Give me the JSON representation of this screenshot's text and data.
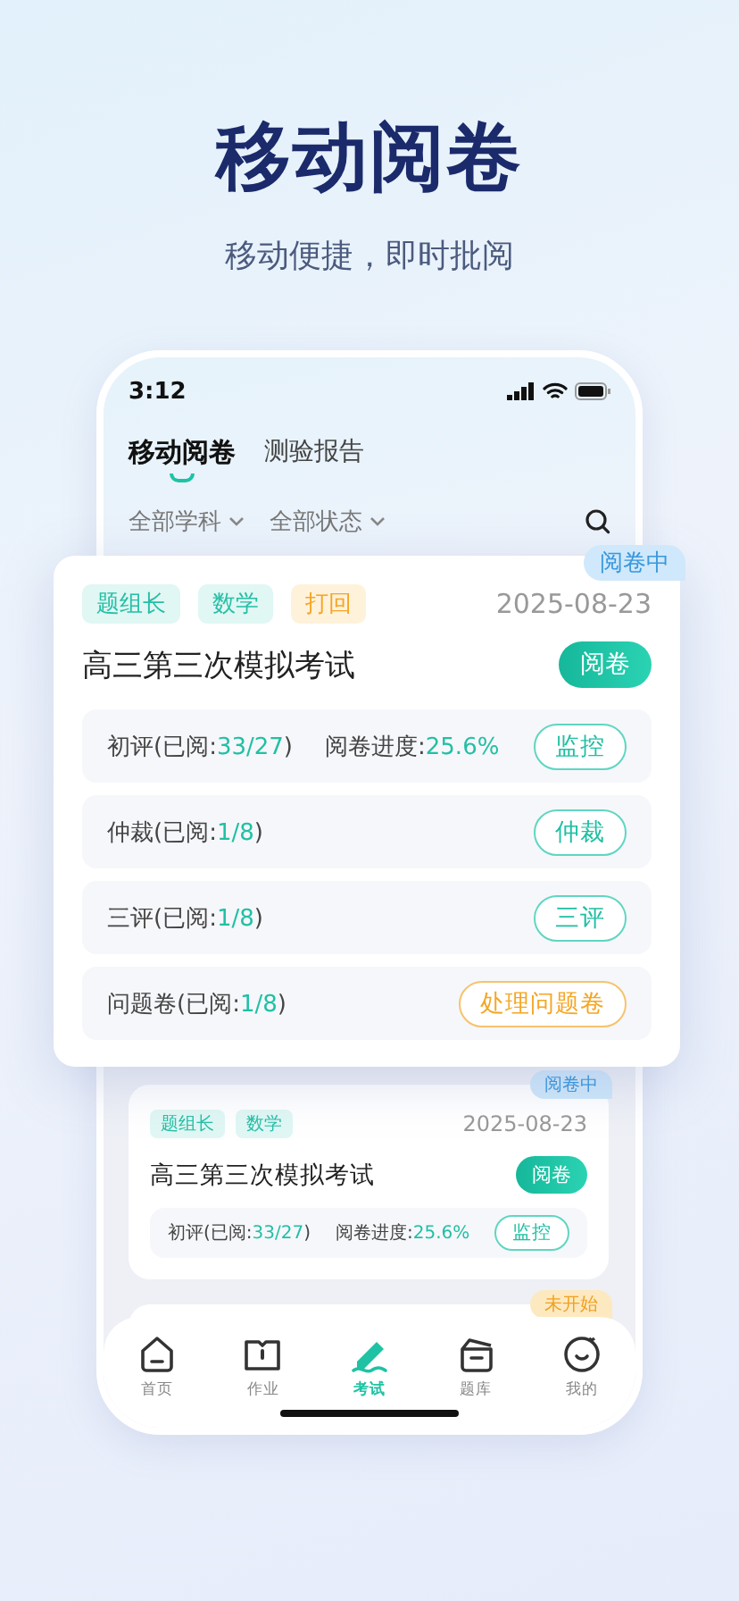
{
  "headline": "移动阅卷",
  "subtitle": "移动便捷，即时批阅",
  "status_bar": {
    "time": "3:12"
  },
  "tabs": [
    {
      "label": "移动阅卷",
      "selected": true
    },
    {
      "label": "测验报告",
      "selected": false
    }
  ],
  "filters": [
    {
      "label": "全部学科"
    },
    {
      "label": "全部状态"
    }
  ],
  "featured_card": {
    "status": {
      "label": "阅卷中",
      "kind": "active"
    },
    "tags": [
      {
        "label": "题组长",
        "kind": "teal"
      },
      {
        "label": "数学",
        "kind": "teal"
      },
      {
        "label": "打回",
        "kind": "orange"
      }
    ],
    "date": "2025-08-23",
    "title": "高三第三次模拟考试",
    "action": "阅卷",
    "stages": [
      {
        "text": "初评(已阅:",
        "count": "33/27",
        "close": ")",
        "progress_label": "阅卷进度:",
        "progress": "25.6%",
        "button": {
          "label": "监控",
          "kind": "teal"
        }
      },
      {
        "text": "仲裁(已阅:",
        "count": "1/8",
        "close": ")",
        "button": {
          "label": "仲裁",
          "kind": "teal"
        }
      },
      {
        "text": "三评(已阅:",
        "count": "1/8",
        "close": ")",
        "button": {
          "label": "三评",
          "kind": "teal"
        }
      },
      {
        "text": "问题卷(已阅:",
        "count": "1/8",
        "close": ")",
        "button": {
          "label": "处理问题卷",
          "kind": "orange"
        }
      }
    ]
  },
  "exam_cards": [
    {
      "status": {
        "label": "阅卷中",
        "kind": "active"
      },
      "tags": [
        {
          "label": "题组长",
          "kind": "teal"
        },
        {
          "label": "数学",
          "kind": "teal"
        }
      ],
      "date": "2025-08-23",
      "title": "高三第三次模拟考试",
      "action": "阅卷",
      "stages": [
        {
          "text": "初评(已阅:",
          "count": "33/27",
          "close": ")",
          "progress_label": "阅卷进度:",
          "progress": "25.6%",
          "button": {
            "label": "监控",
            "kind": "teal"
          }
        }
      ]
    },
    {
      "status": {
        "label": "未开始",
        "kind": "pending"
      }
    }
  ],
  "tab_bar": [
    {
      "label": "首页",
      "selected": false
    },
    {
      "label": "作业",
      "selected": false
    },
    {
      "label": "考试",
      "selected": true
    },
    {
      "label": "题库",
      "selected": false
    },
    {
      "label": "我的",
      "selected": false
    }
  ]
}
